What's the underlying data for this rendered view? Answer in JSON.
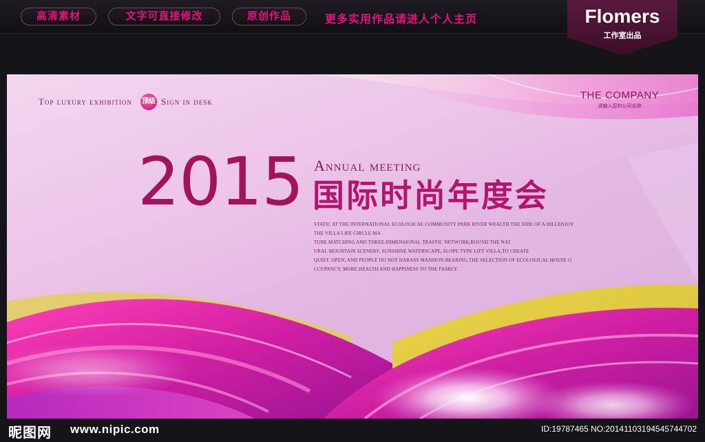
{
  "topbar": {
    "pills": [
      "高清素材",
      "文字可直接修改",
      "原创作品"
    ],
    "link": "更多实用作品请进人个人主页",
    "brand": {
      "name": "Flomers",
      "sub": "工作室出品"
    }
  },
  "poster": {
    "tagline_left": "Top luxury exhibition",
    "badge": "顶级",
    "tagline_right": "Sign in desk",
    "company": {
      "name": "THE COMPANY",
      "sub": "请输入您的公司名称"
    },
    "year": "2015",
    "annual": "Annual meeting",
    "title": "国际时尚年度会",
    "description": [
      "STATIC AT THE INTERNATIONAL ECOLOGICAL COMMUNITY PARK RIVER WEALTH THE SIDE OF A HILLENJOY",
      "THE VILLA LIFE CIRCLE MA",
      "TURE MATCHING AND THREE-DIMENSIONAL TRAFFIC NETWORK,ROUND THE NAT",
      "URAL MOUNTAIN SCENERY, SUNSHINE WATERSCAPE, SLOPE TYPE LIFT VILLA,TO CREATE",
      "QUIET, OPEN, AND PEOPLE DO NOT HARASS MANSION BEARING,THE SELECTION OF ECOLOGICAL HOUSE O",
      "CCUPANCY, MORE HEALTH AND HAPPINESS TO THE FAMILY."
    ],
    "colors": {
      "accent": "#b0166e",
      "year": "#a0145e",
      "background": "#ecc4e8"
    }
  },
  "footer": {
    "logo": "昵图网",
    "url": "www.nipic.com",
    "id_text": "ID:19787465 NO:20141103194545744702"
  }
}
